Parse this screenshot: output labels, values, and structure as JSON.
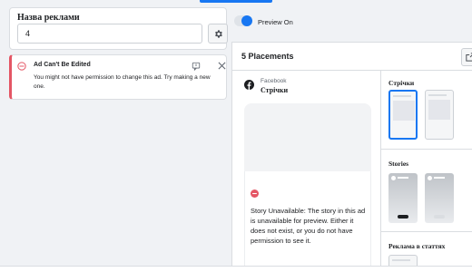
{
  "ad_name": {
    "label": "Назва реклами",
    "value": "4"
  },
  "error_banner": {
    "title": "Ad Can't Be Edited",
    "message": "You might not have permission to change this ad. Try making a new one."
  },
  "preview": {
    "toggle_label": "Preview On",
    "toggle_state": "on",
    "placements_title": "5 Placements",
    "platform": "Facebook",
    "placement_name": "Стрічки",
    "story_error": "Story Unavailable: The story in this ad is unavailable for preview. Either it does not exist, or you do not have permission to see it."
  },
  "placements_sections": {
    "feeds": "Стрічки",
    "stories": "Stories",
    "articles": "Реклама в статтях"
  },
  "colors": {
    "accent": "#1877f2",
    "error": "#e45564"
  }
}
